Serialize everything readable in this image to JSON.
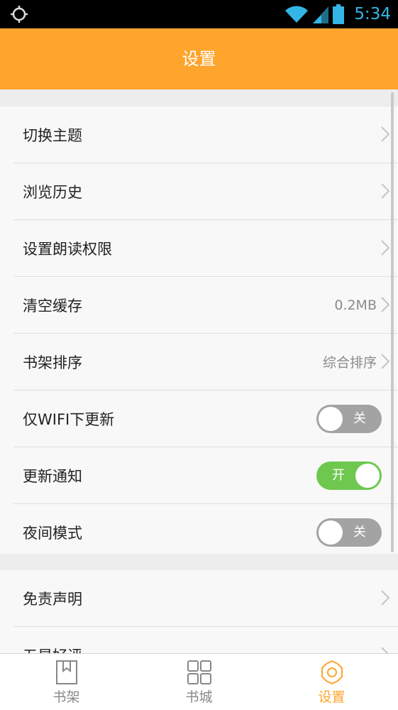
{
  "status_bar": {
    "time": "5:34"
  },
  "header": {
    "title": "设置"
  },
  "settings": {
    "theme": {
      "label": "切换主题"
    },
    "history": {
      "label": "浏览历史"
    },
    "read_permission": {
      "label": "设置朗读权限"
    },
    "cache": {
      "label": "清空缓存",
      "value": "0.2MB"
    },
    "shelf_sort": {
      "label": "书架排序",
      "value": "综合排序"
    },
    "wifi_update": {
      "label": "仅WIFI下更新",
      "toggle_text": "关",
      "on": false
    },
    "update_notify": {
      "label": "更新通知",
      "toggle_text": "开",
      "on": true
    },
    "night_mode": {
      "label": "夜间模式",
      "toggle_text": "关",
      "on": false
    },
    "disclaimer": {
      "label": "免责声明"
    },
    "rate": {
      "label": "五星好评"
    }
  },
  "tabs": [
    {
      "label": "书架",
      "icon": "bookshelf-icon"
    },
    {
      "label": "书城",
      "icon": "grid-icon"
    },
    {
      "label": "设置",
      "icon": "gear-icon",
      "active": true
    }
  ],
  "colors": {
    "accent": "#ffa42c",
    "toggle_on": "#6ec84f",
    "toggle_off": "#a3a3a3",
    "status_icon": "#33b5e5"
  }
}
